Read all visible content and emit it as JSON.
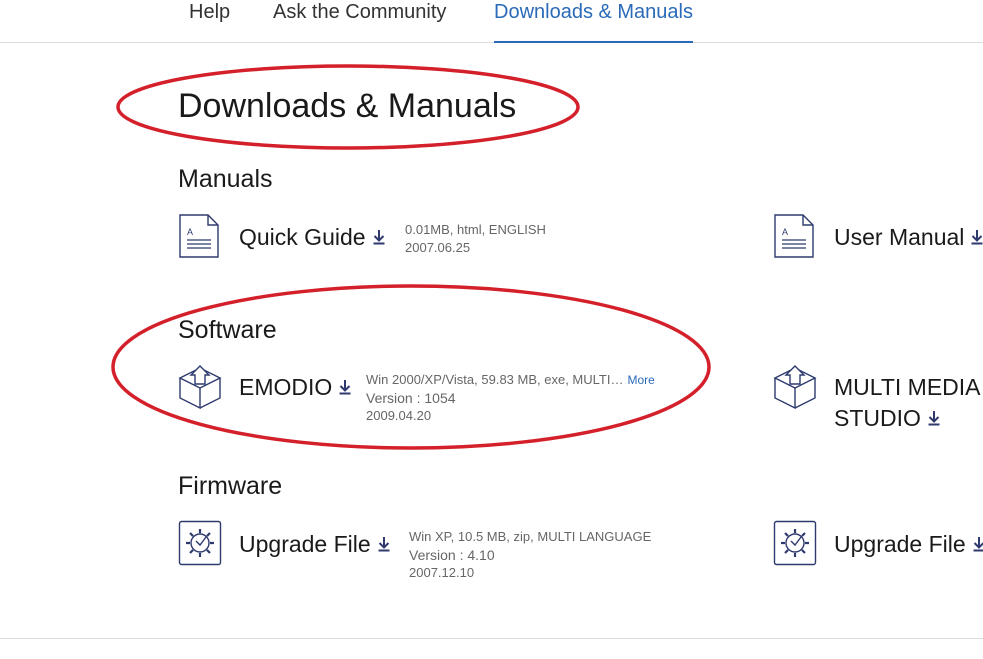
{
  "nav": {
    "items": [
      {
        "label": "Help"
      },
      {
        "label": "Ask the Community"
      },
      {
        "label": "Downloads & Manuals"
      }
    ]
  },
  "page": {
    "title": "Downloads & Manuals"
  },
  "manuals": {
    "title": "Manuals",
    "items": [
      {
        "name": "Quick Guide",
        "meta": [
          "0.01MB, html, ENGLISH",
          "2007.06.25"
        ]
      },
      {
        "name": "User Manual"
      }
    ]
  },
  "software": {
    "title": "Software",
    "items": [
      {
        "name": "EMODIO",
        "meta": [
          "Win 2000/XP/Vista, 59.83 MB, exe, MULTI…",
          "Version : 1054",
          "2009.04.20"
        ],
        "more": "More"
      },
      {
        "name_line1": "MULTI MEDIA",
        "name_line2": "STUDIO"
      }
    ]
  },
  "firmware": {
    "title": "Firmware",
    "items": [
      {
        "name": "Upgrade File",
        "meta": [
          "Win XP, 10.5 MB, zip, MULTI LANGUAGE",
          "Version : 4.10",
          "2007.12.10"
        ]
      },
      {
        "name": "Upgrade File"
      }
    ]
  },
  "icons": {
    "document": "document-icon",
    "software": "box-upload-icon",
    "firmware": "gear-upgrade-icon",
    "download": "download-arrow-icon"
  },
  "colors": {
    "accent": "#2a6ab8",
    "icon_stroke": "#2e3a6e",
    "annotation": "#d4202a"
  }
}
